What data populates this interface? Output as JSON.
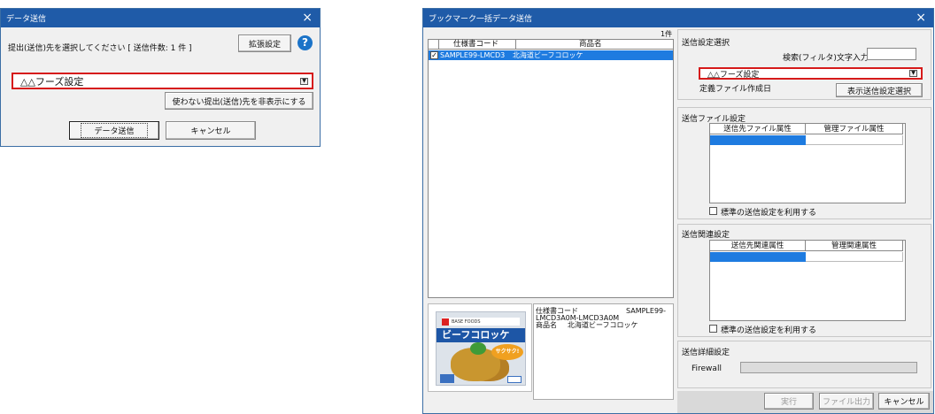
{
  "dialog1": {
    "title": "データ送信",
    "close": "×",
    "prompt": "提出(送信)先を選択してください [ 送信件数: 1 件 ]",
    "ext_button": "拡張設定",
    "help_icon": "?",
    "dropdown_value": "△△フーズ設定",
    "hide_button": "使わない提出(送信)先を非表示にする",
    "send_button": "データ送信",
    "cancel_button": "キャンセル"
  },
  "dialog2": {
    "title": "ブックマーク一括データ送信",
    "close": "×",
    "count": "1件",
    "columns": [
      "仕様書コード",
      "商品名"
    ],
    "rows": [
      {
        "code": "SAMPLE99-LMCD3",
        "name": "北海道ビーフコロッケ",
        "checked": true
      }
    ],
    "detail": {
      "line1_label": "仕様書コード",
      "line1_value": "SAMPLE99-",
      "line2": "LMCD3A0M-LMCD3A0M",
      "line3_label": "商品名",
      "line3_value": "北海道ビーフコロッケ"
    },
    "product_image": {
      "brand": "BASE FOODS",
      "name": "ビーフコロッケ",
      "badge": "サクサク!"
    },
    "send_settings": {
      "title": "送信設定選択",
      "filter_label": "検索(フィルタ)文字入力",
      "filter_value": "",
      "dropdown_value": "△△フーズ設定",
      "def_file_label": "定義ファイル作成日",
      "show_button": "表示送信設定選択"
    },
    "file_settings": {
      "title": "送信ファイル設定",
      "columns": [
        "送信先ファイル属性",
        "管理ファイル属性"
      ],
      "checkbox_label": "標準の送信設定を利用する"
    },
    "related_settings": {
      "title": "送信関連設定",
      "columns": [
        "送信先関連属性",
        "管理関連属性"
      ],
      "checkbox_label": "標準の送信設定を利用する"
    },
    "detail_settings": {
      "title": "送信詳細設定",
      "firewall_label": "Firewall",
      "firewall_value": ""
    },
    "footer": {
      "run_button": "実行",
      "file_out_button": "ファイル出力",
      "cancel_button": "キャンセル"
    }
  },
  "colors": {
    "titlebar": "#1f5ba8",
    "selection": "#1e7be0",
    "highlight_border": "#d61a1a",
    "help": "#1b73c8"
  }
}
